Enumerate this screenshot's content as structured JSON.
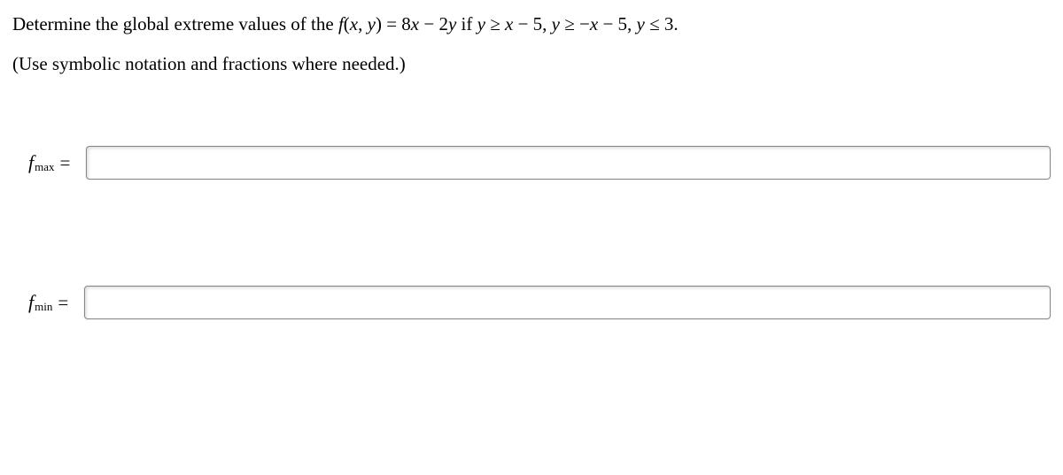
{
  "question": {
    "prefix": "Determine the global extreme values of the ",
    "func": "f",
    "args_open": "(",
    "var1": "x",
    "comma": ", ",
    "var2": "y",
    "args_close": ")",
    "eq": " = 8",
    "x1": "x",
    "minus1": " − 2",
    "y1": "y",
    "if": " if ",
    "c1_y": "y",
    "c1_ge": " ≥ ",
    "c1_x": "x",
    "c1_m5": " − 5, ",
    "c2_y": "y",
    "c2_ge": " ≥ −",
    "c2_x": "x",
    "c2_m5": " − 5, ",
    "c3_y": "y",
    "c3_le": " ≤ 3."
  },
  "instruction": "(Use symbolic notation and fractions where needed.)",
  "labels": {
    "fmax_f": "f",
    "fmax_sub": "max",
    "fmax_eq": " =",
    "fmin_f": "f",
    "fmin_sub": "min",
    "fmin_eq": " ="
  },
  "inputs": {
    "fmax_value": "",
    "fmin_value": ""
  }
}
